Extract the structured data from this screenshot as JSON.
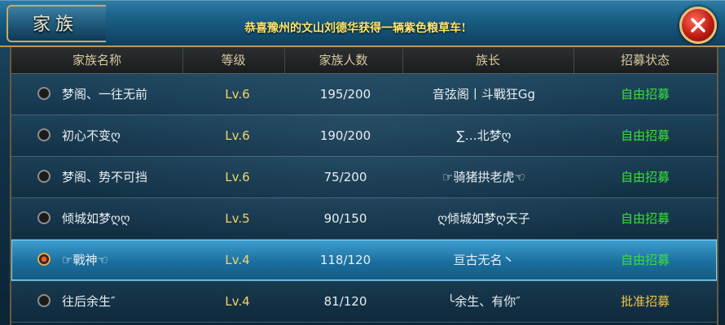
{
  "window": {
    "title": "家族",
    "announcement": "恭喜豫州的文山刘德华获得一辆紫色粮草车!"
  },
  "table": {
    "headers": [
      "家族名称",
      "等级",
      "家族人数",
      "族长",
      "招募状态"
    ],
    "rows": [
      {
        "name": "梦阁、一往无前",
        "level": "Lv.6",
        "members": "195/200",
        "leader": "音弦阁丨斗戰狂Gg",
        "status": "自由招募",
        "selected": false
      },
      {
        "name": "初心不变ღ",
        "level": "Lv.6",
        "members": "190/200",
        "leader": "∑…北梦ღ",
        "status": "自由招募",
        "selected": false
      },
      {
        "name": "梦阁、势不可挡",
        "level": "Lv.6",
        "members": "75/200",
        "leader": "☞骑猪拱老虎☜",
        "status": "自由招募",
        "selected": false
      },
      {
        "name": "倾城如梦ღღ",
        "level": "Lv.5",
        "members": "90/150",
        "leader": "ღ倾城如梦ღ天子",
        "status": "自由招募",
        "selected": false
      },
      {
        "name": "☞戰神☜",
        "level": "Lv.4",
        "members": "118/120",
        "leader": "亘古无名丶",
        "status": "自由招募",
        "selected": true
      },
      {
        "name": "往后余生″",
        "level": "Lv.4",
        "members": "81/120",
        "leader": "╰余生、有你″",
        "status": "批准招募",
        "selected": false
      }
    ]
  },
  "colors": {
    "status_free": "#39e03a",
    "status_approve": "#f2c542",
    "level": "#f2d46a",
    "selected_row": "#2a8cc0"
  }
}
